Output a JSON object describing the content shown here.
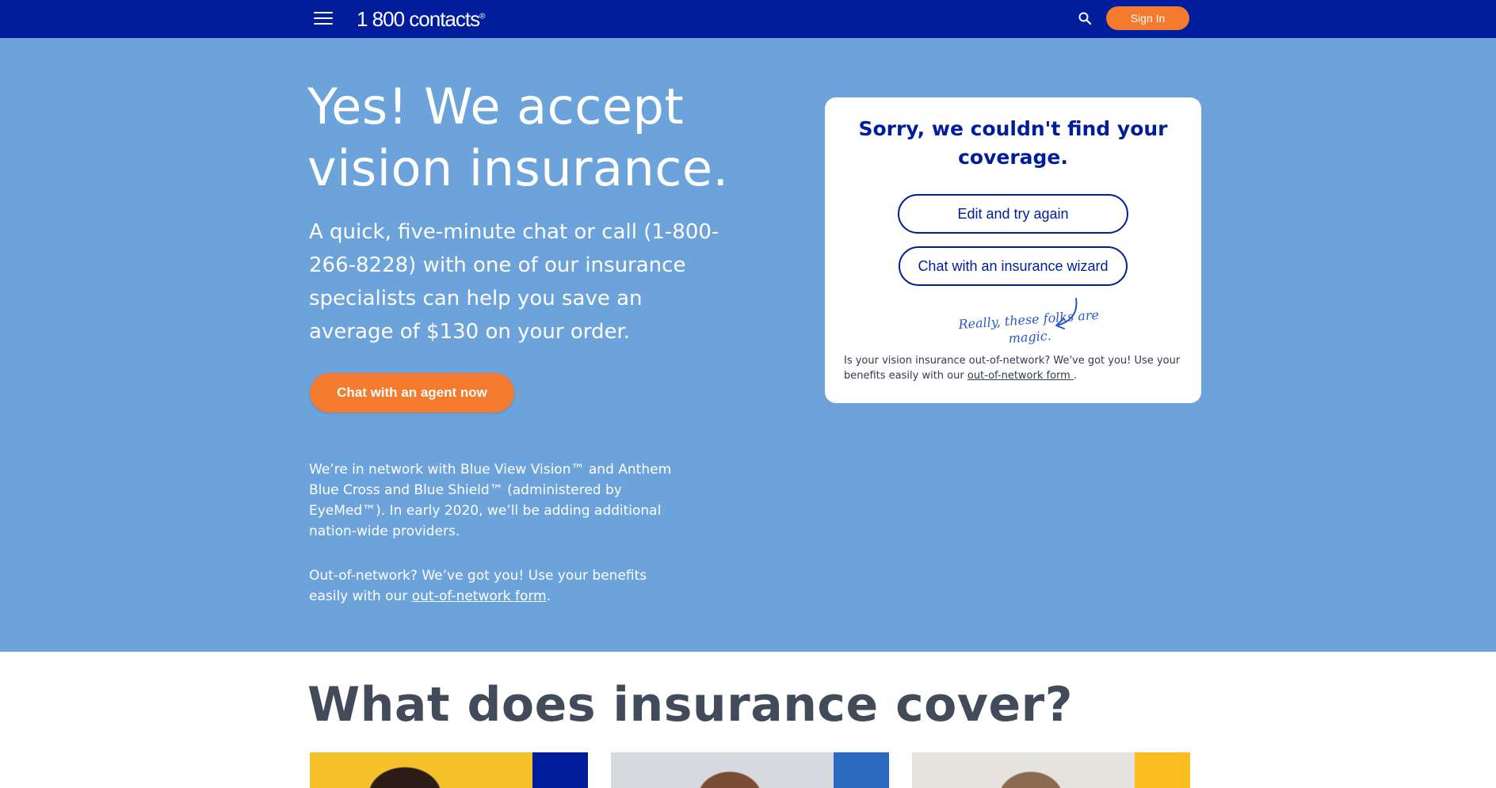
{
  "header": {
    "logo_text": "1 800 contacts",
    "logo_reg": "®",
    "search_icon": "search-icon",
    "menu_icon": "hamburger-menu-icon",
    "signin_label": "Sign In",
    "colors": {
      "bar": "#001d9b",
      "accent": "#f47a2e"
    }
  },
  "hero": {
    "title": "Yes! We accept vision insurance.",
    "text": "A quick, five-minute chat or call (1-800-266-8228) with one of our insurance specialists can help you save an average of $130 on your order.",
    "cta_label": "Chat with an agent now",
    "network_text": "We’re in network with Blue View Vision™ and Anthem Blue Cross and Blue Shield™ (administered by EyeMed™). In early 2020, we’ll be adding additional nation-wide providers.",
    "oon_prefix": "Out-of-network? We’ve got you! Use your benefits easily with our ",
    "oon_link": "out-of-network form",
    "oon_suffix": ".",
    "background": "#6da3db"
  },
  "card": {
    "title": "Sorry, we couldn't find your coverage.",
    "edit_label": "Edit and try again",
    "wizard_label": "Chat with an insurance wizard",
    "note": "Really, these folks are magic.",
    "footnote_prefix": "Is your vision insurance out-of-network? We've got you! Use your benefits easily with our ",
    "footnote_link": "out-of-network form ",
    "footnote_suffix": "."
  },
  "cover": {
    "heading": "What does insurance cover?"
  }
}
